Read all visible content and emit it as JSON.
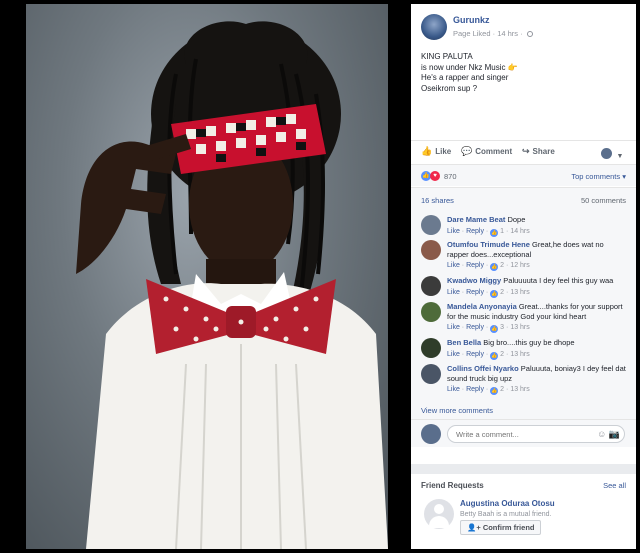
{
  "post": {
    "author": "Gurunkz",
    "meta": "Page Liked · 14 hrs ·",
    "text_lines": [
      "KING PALUTA",
      "is now under Nkz Music",
      "He's a rapper and singer",
      "Oseikrom sup ?"
    ],
    "emoji": "👉"
  },
  "actions": {
    "like": "Like",
    "comment": "Comment",
    "share": "Share"
  },
  "reactions": {
    "count": "870",
    "sort": "Top comments ▾"
  },
  "counts": {
    "shares": "16 shares",
    "comments": "50 comments"
  },
  "comments": [
    {
      "name": "Dare Mame Beat",
      "text": "Dope",
      "like": "Like",
      "reply": "Reply",
      "likes": "1",
      "time": "14 hrs",
      "avatar_color": "#6b7a8f"
    },
    {
      "name": "Otumfou Trimude Hene",
      "text": "Great,he does wat no rapper does...exceptional",
      "like": "Like",
      "reply": "Reply",
      "likes": "2",
      "time": "12 hrs",
      "avatar_color": "#8a5a4a"
    },
    {
      "name": "Kwadwo Miggy",
      "text": "Paluuuuta I dey feel this guy waa",
      "like": "Like",
      "reply": "Reply",
      "likes": "2",
      "time": "13 hrs",
      "avatar_color": "#3b3b3b"
    },
    {
      "name": "Mandela Anyonayia",
      "text": "Great....thanks for your support for the music industry God your kind heart",
      "like": "Like",
      "reply": "Reply",
      "likes": "3",
      "time": "13 hrs",
      "avatar_color": "#4e6b3a"
    },
    {
      "name": "Ben Bella",
      "text": "Big bro....this guy be dhope",
      "like": "Like",
      "reply": "Reply",
      "likes": "2",
      "time": "13 hrs",
      "avatar_color": "#2f3d2a"
    },
    {
      "name": "Collins Offei Nyarko",
      "text": "Paluuuta, boniay3 I dey feel dat sound truck big upz",
      "like": "Like",
      "reply": "Reply",
      "likes": "2",
      "time": "13 hrs",
      "avatar_color": "#4a5566"
    }
  ],
  "view_more": "View more comments",
  "write": {
    "placeholder": "Write a comment..."
  },
  "friend_requests": {
    "heading": "Friend Requests",
    "see_all": "See all",
    "name": "Augustina Oduraa Otosu",
    "mutual": "Betty Baah is a mutual friend.",
    "button": "Confirm friend"
  },
  "colors": {
    "link": "#385898",
    "like_blue": "#5890ff",
    "love_red": "#f0284a",
    "bow_tie": "#b3202f",
    "headband_red": "#c8102e"
  },
  "icons": [
    "like-icon",
    "comment-icon",
    "share-icon",
    "globe-icon",
    "emoji-icon",
    "camera-icon",
    "user-plus-icon"
  ]
}
